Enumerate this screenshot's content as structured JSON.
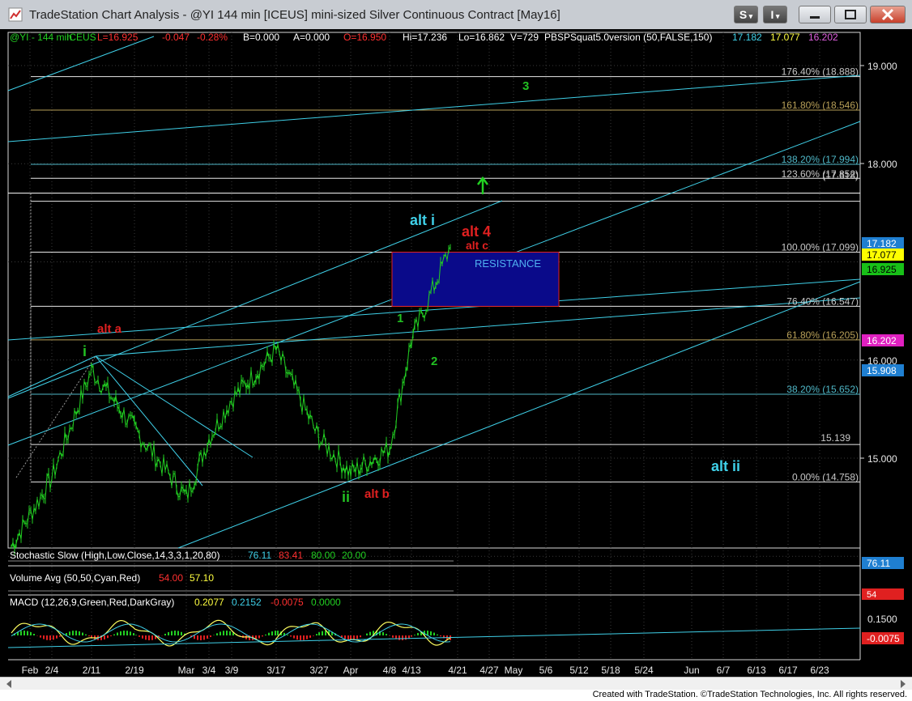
{
  "window": {
    "title": "TradeStation Chart Analysis - @YI 144 min [ICEUS] mini-sized Silver Continuous Contract [May16]",
    "btn_s": "S",
    "btn_i": "I"
  },
  "header": {
    "symbol": "@YI - 144 min",
    "exchange": "ICEUS",
    "last": "L=16.925",
    "change": "-0.047",
    "pct": "-0.28%",
    "bid": "B=0.000",
    "ask": "A=0.000",
    "open": "O=16.950",
    "high": "Hi=17.236",
    "low": "Lo=16.862",
    "volume": "V=729",
    "study": "PBSPSquat5.0version (50,FALSE,150)",
    "v1": "17.182",
    "v2": "17.077",
    "v3": "16.202"
  },
  "indicators": {
    "stoch": {
      "label": "Stochastic Slow (High,Low,Close,14,3,3,1,20,80)",
      "v1": "76.11",
      "v2": "83.41",
      "v3": "80.00",
      "v4": "20.00",
      "axis_value": "76.11"
    },
    "volume": {
      "label": "Volume Avg (50,50,Cyan,Red)",
      "v1": "54.00",
      "v2": "57.10",
      "axis_value": "54"
    },
    "macd": {
      "label": "MACD (12,26,9,Green,Red,DarkGray)",
      "v1": "0.2077",
      "v2": "0.2152",
      "v3": "-0.0075",
      "v4": "0.0000",
      "axis_value1": "0.1500",
      "axis_value2": "-0.0075"
    }
  },
  "price_axis": {
    "ticks": [
      "19.000",
      "18.000",
      "16.000",
      "15.000"
    ],
    "badges": [
      {
        "value": "17.182",
        "color": "#1f7fd1"
      },
      {
        "value": "17.077",
        "color": "#ffff00"
      },
      {
        "value": "16.925",
        "color": "#18c018"
      },
      {
        "value": "16.202",
        "color": "#e020c0"
      },
      {
        "value": "15.908",
        "color": "#1f7fd1"
      }
    ]
  },
  "fib_labels": [
    {
      "text": "176.40% (18.888)",
      "color": "#c8c8c8"
    },
    {
      "text": "161.80% (18.546)",
      "color": "#b8a058"
    },
    {
      "text": "138.20% (17.994)",
      "color": "#4fb8c8"
    },
    {
      "text": "123.60% (17.852)",
      "color": "#c8c8c8"
    },
    {
      "text": "(17.618)",
      "color": "#c8c8c8"
    },
    {
      "text": "100.00% (17.099)",
      "color": "#c8c8c8"
    },
    {
      "text": "76.40% (16.547)",
      "color": "#c8c8c8"
    },
    {
      "text": "61.80% (16.205)",
      "color": "#b8a058"
    },
    {
      "text": "38.20% (15.652)",
      "color": "#4fb8c8"
    },
    {
      "text": "15.139",
      "color": "#c8c8c8"
    },
    {
      "text": "0.00% (14.758)",
      "color": "#c8c8c8"
    }
  ],
  "annotations": [
    {
      "text": "3",
      "color": "#22c022"
    },
    {
      "text": "alt i",
      "color": "#3fd0e8"
    },
    {
      "text": "alt 4",
      "color": "#e02020"
    },
    {
      "text": "alt c",
      "color": "#e02020"
    },
    {
      "text": "RESISTANCE",
      "color": "#4fb0f0"
    },
    {
      "text": "alt a",
      "color": "#e02020"
    },
    {
      "text": "i",
      "color": "#22c022"
    },
    {
      "text": "1",
      "color": "#22c022"
    },
    {
      "text": "2",
      "color": "#22c022"
    },
    {
      "text": "ii",
      "color": "#22c022"
    },
    {
      "text": "alt b",
      "color": "#e02020"
    },
    {
      "text": "alt ii",
      "color": "#3fd0e8"
    }
  ],
  "chart_data": {
    "type": "line",
    "title": "@YI 144 min mini-sized Silver Continuous Contract",
    "x_ticks": [
      "Feb",
      "2/4",
      "2/11",
      "2/19",
      "Mar",
      "3/4",
      "3/9",
      "3/17",
      "3/27",
      "Apr",
      "4/8",
      "4/13",
      "4/21",
      "4/27",
      "May",
      "5/6",
      "5/12",
      "5/18",
      "5/24",
      "Jun",
      "6/7",
      "6/13",
      "6/17",
      "6/23"
    ],
    "series": [
      {
        "name": "@YI",
        "x": [
          "Feb",
          "2/4",
          "2/11",
          "2/19",
          "Mar",
          "3/4",
          "3/9",
          "3/17",
          "3/27",
          "Apr",
          "4/8",
          "4/13",
          "4/21"
        ],
        "values": [
          14.1,
          14.8,
          15.9,
          15.3,
          14.6,
          15.2,
          15.6,
          16.1,
          15.2,
          14.85,
          15.1,
          16.2,
          17.15
        ]
      }
    ],
    "ylim": [
      13.7,
      19.4
    ],
    "fib_levels": [
      18.888,
      18.546,
      17.994,
      17.852,
      17.618,
      17.099,
      16.547,
      16.205,
      15.652,
      15.139,
      14.758
    ],
    "resistance_zone": [
      16.547,
      17.099
    ]
  },
  "footer": {
    "credit": "Created with TradeStation. ©TradeStation Technologies, Inc. All rights reserved."
  }
}
